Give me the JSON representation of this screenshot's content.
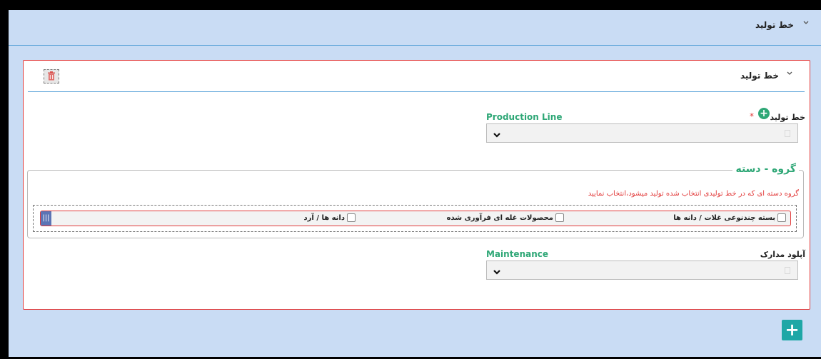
{
  "outer_panel": {
    "title": "خط تولید",
    "chevron": "⌄"
  },
  "inner_card": {
    "title": "خط تولید",
    "chevron": "⌄",
    "delete_icon": "trash-icon"
  },
  "production_line": {
    "label_en": "Production Line",
    "label_fa": "خط تولید",
    "required_mark": "*",
    "add_icon": "plus-circle-icon",
    "value": ""
  },
  "group": {
    "legend": "گروه - دسته",
    "note": "گروه دسته ای که در خط تولیدی انتخاب شده تولید میشود،انتخاب نمایید",
    "options": [
      {
        "label": "بسته چندنوعی غلات / دانه ها",
        "checked": false
      },
      {
        "label": "محصولات غله ای فرآوری شده",
        "checked": false
      },
      {
        "label": "دانه ها / آرد",
        "checked": false
      }
    ],
    "grip_icon": "drag-handle-icon"
  },
  "documents": {
    "label_en": "Maintenance",
    "label_fa": "آپلود مدارک",
    "value": ""
  },
  "footer": {
    "add_icon": "plus-icon"
  },
  "colors": {
    "accent_green": "#2ea776",
    "error_red": "#e23b3b",
    "panel_blue": "#c9dcf4",
    "add_button": "#1ea7a6"
  }
}
